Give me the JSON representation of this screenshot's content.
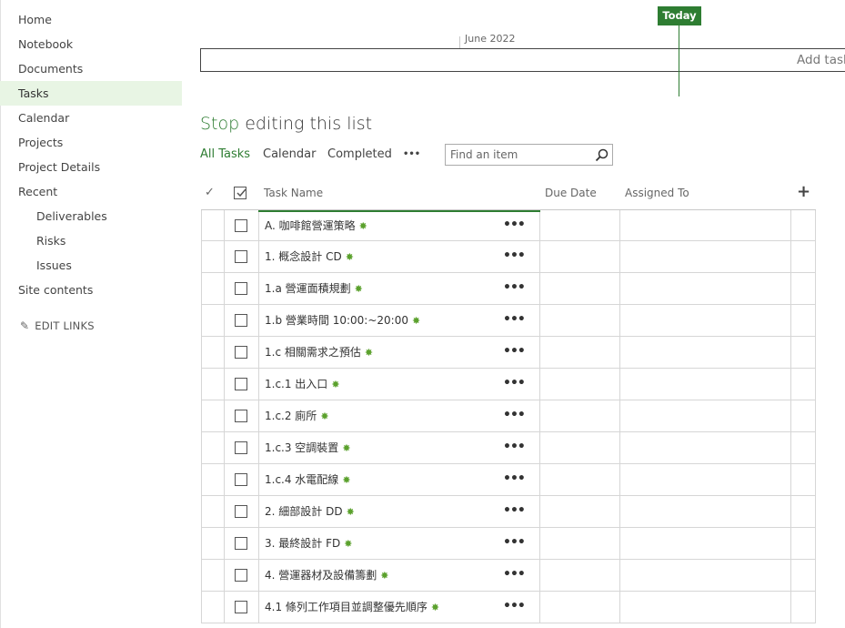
{
  "nav": {
    "items": [
      {
        "label": "Home",
        "sub": false,
        "selected": false
      },
      {
        "label": "Notebook",
        "sub": false,
        "selected": false
      },
      {
        "label": "Documents",
        "sub": false,
        "selected": false
      },
      {
        "label": "Tasks",
        "sub": false,
        "selected": true
      },
      {
        "label": "Calendar",
        "sub": false,
        "selected": false
      },
      {
        "label": "Projects",
        "sub": false,
        "selected": false
      },
      {
        "label": "Project Details",
        "sub": false,
        "selected": false
      },
      {
        "label": "Recent",
        "sub": false,
        "selected": false
      },
      {
        "label": "Deliverables",
        "sub": true,
        "selected": false
      },
      {
        "label": "Risks",
        "sub": true,
        "selected": false
      },
      {
        "label": "Issues",
        "sub": true,
        "selected": false
      },
      {
        "label": "Site contents",
        "sub": false,
        "selected": false
      }
    ],
    "edit_links": "EDIT LINKS"
  },
  "timeline": {
    "month": "June 2022",
    "today": "Today",
    "add_task": "Add task"
  },
  "title": {
    "stop": "Stop",
    "rest": " editing this list"
  },
  "views": {
    "all_tasks": "All Tasks",
    "calendar": "Calendar",
    "completed": "Completed",
    "more": "•••"
  },
  "search": {
    "placeholder": "Find an item"
  },
  "columns": {
    "check": "✓",
    "task_name": "Task Name",
    "due_date": "Due Date",
    "assigned_to": "Assigned To",
    "add": "+"
  },
  "tasks": [
    "A. 咖啡館營運策略",
    "1. 概念設計 CD",
    "1.a 營運面積規劃",
    "1.b 營業時間 10:00:~20:00",
    "1.c 相關需求之預估",
    "1.c.1 出入口",
    "1.c.2 廁所",
    "1.c.3 空調裝置",
    "1.c.4 水電配線",
    "2. 細部設計 DD",
    "3. 最終設計 FD",
    "4. 營運器材及設備籌劃",
    "4.1 條列工作項目並調整優先順序"
  ],
  "new_icon": "✸",
  "row_more": "•••",
  "colors": {
    "accent": "#2e7d32",
    "selected_bg": "#e8f5e4",
    "new_icon": "#5ba12d"
  }
}
